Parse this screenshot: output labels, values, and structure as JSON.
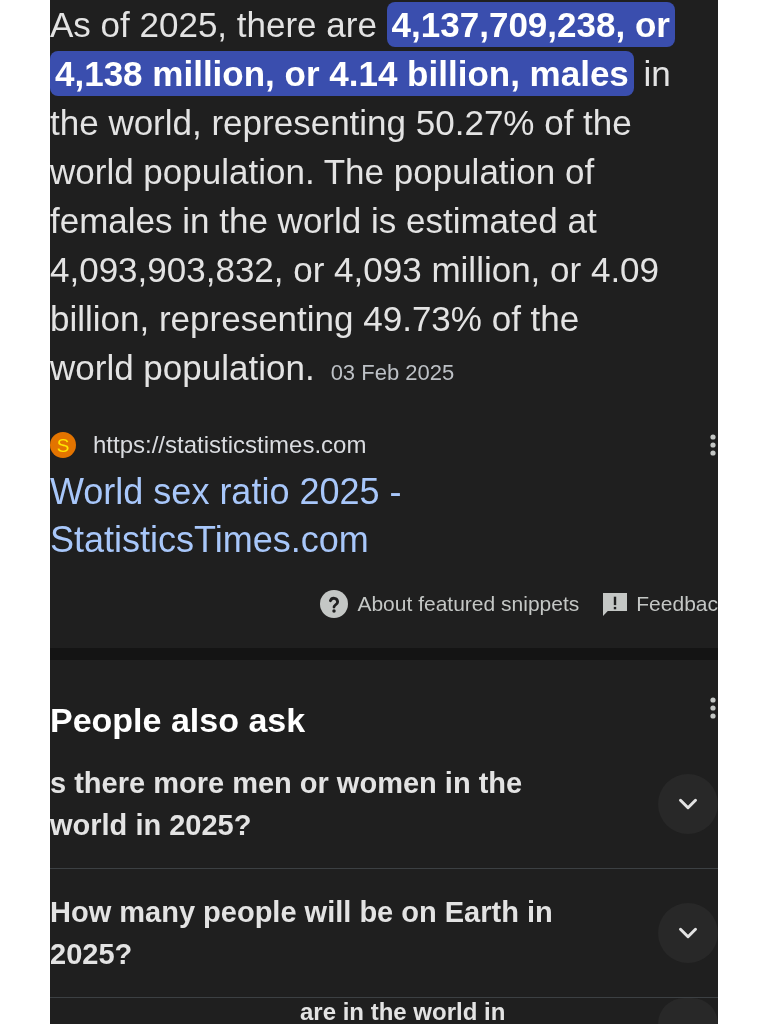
{
  "snippet": {
    "lines": [
      "As of 2025, there are **4,137,709,238, or**",
      "**4,138 million, or 4.14 billion, males** in",
      "the world, representing 50.27% of the",
      "world population. The population of",
      "females in the world is estimated at",
      "4,093,903,832, or 4,093 million, or 4.09",
      "billion, representing 49.73% of the",
      "world population."
    ],
    "date": "03 Feb 2025"
  },
  "source": {
    "favicon_letter": "S",
    "url": "https://statisticstimes.com",
    "title": "World sex ratio 2025 - StatisticsTimes.com"
  },
  "footer_links": [
    {
      "kind": "about",
      "label": "About featured snippets"
    },
    {
      "kind": "feedback",
      "label": "Feedbac"
    }
  ],
  "people_also_ask": {
    "title": "People also ask",
    "questions": [
      {
        "kind": "full",
        "lines": [
          "s there more men or women in the",
          "world in 2025?"
        ],
        "expanded": false
      },
      {
        "kind": "full",
        "lines": [
          "How many people will be on Earth in",
          "2025?"
        ],
        "expanded": false
      },
      {
        "kind": "partial",
        "lines": [
          "are in the world in"
        ]
      }
    ]
  }
}
